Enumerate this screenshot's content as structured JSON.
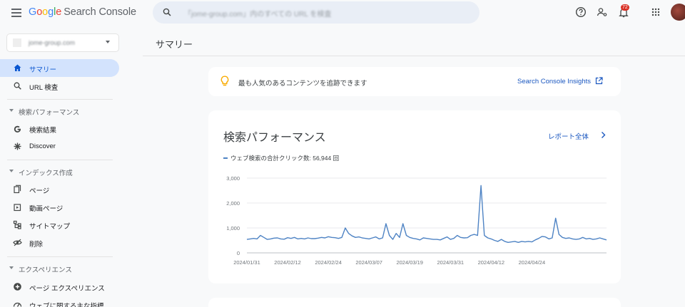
{
  "app": {
    "logo_google": [
      "G",
      "o",
      "o",
      "g",
      "l",
      "e"
    ],
    "logo_product": "Search Console",
    "search_placeholder": "「jome-group.com」内のすべての URL を検査",
    "notification_count": "72"
  },
  "sidebar": {
    "property": "jome-group.com",
    "items": [
      {
        "label": "サマリー",
        "icon": "home-icon",
        "active": true
      },
      {
        "label": "URL 検査",
        "icon": "search-icon"
      },
      {
        "section": "検索パフォーマンス"
      },
      {
        "label": "検索結果",
        "icon": "google-g-icon"
      },
      {
        "label": "Discover",
        "icon": "asterisk-icon"
      },
      {
        "section": "インデックス作成"
      },
      {
        "label": "ページ",
        "icon": "pages-icon"
      },
      {
        "label": "動画ページ",
        "icon": "video-pages-icon"
      },
      {
        "label": "サイトマップ",
        "icon": "sitemap-icon"
      },
      {
        "label": "削除",
        "icon": "removal-icon"
      },
      {
        "section": "エクスペリエンス"
      },
      {
        "label": "ページ エクスペリエンス",
        "icon": "page-experience-icon"
      },
      {
        "label": "ウェブに関する主な指標",
        "icon": "web-vitals-icon"
      }
    ]
  },
  "main": {
    "page_title": "サマリー",
    "banner": {
      "text": "最も人気のあるコンテンツを追跡できます",
      "link": "Search Console Insights"
    },
    "performance": {
      "title": "検索パフォーマンス",
      "report_link": "レポート全体",
      "legend": "ウェブ検索の合計クリック数: 56,944 回"
    }
  },
  "colors": {
    "accent": "#0b57d0",
    "series": "#4e83c4",
    "active_nav": "#d3e3fd",
    "notification": "#d93025"
  },
  "chart_data": {
    "type": "line",
    "series": [
      {
        "name": "ウェブ検索の合計クリック数",
        "values": [
          540,
          560,
          580,
          560,
          700,
          620,
          540,
          560,
          590,
          600,
          560,
          550,
          610,
          580,
          620,
          560,
          580,
          560,
          600,
          570,
          570,
          590,
          620,
          600,
          650,
          620,
          610,
          580,
          620,
          1000,
          780,
          680,
          620,
          640,
          600,
          580,
          560,
          600,
          640,
          560,
          600,
          1170,
          700,
          540,
          780,
          620,
          1170,
          700,
          620,
          580,
          560,
          520,
          600,
          580,
          560,
          540,
          540,
          520,
          580,
          640,
          540,
          580,
          700,
          620,
          600,
          610,
          700,
          740,
          700,
          2700,
          700,
          600,
          560,
          500,
          460,
          540,
          460,
          420,
          440,
          460,
          420,
          460,
          440,
          460,
          440,
          520,
          580,
          660,
          640,
          560,
          600,
          1390,
          740,
          620,
          580,
          600,
          560,
          540,
          560,
          620,
          560,
          580,
          540,
          560,
          600,
          560,
          520
        ]
      }
    ],
    "x_ticks": [
      "2024/01/31",
      "2024/02/12",
      "2024/02/24",
      "2024/03/07",
      "2024/03/19",
      "2024/03/31",
      "2024/04/12",
      "2024/04/24"
    ],
    "y_ticks": [
      "3,000",
      "2,000",
      "1,000",
      "0"
    ],
    "ylim": [
      0,
      3000
    ],
    "grid": true
  }
}
